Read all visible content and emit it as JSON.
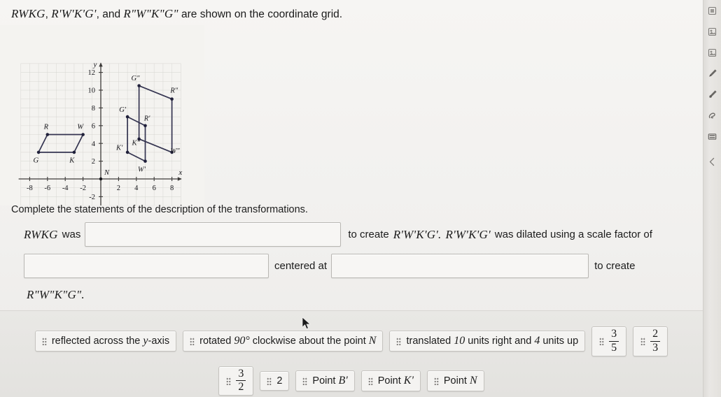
{
  "prompt": {
    "fig1": "RWKG",
    "fig2": "R'W'K'G'",
    "fig3": "R\"W\"K\"G\"",
    "comma": ", ",
    "and": ", and ",
    "tail": " are shown on the coordinate grid."
  },
  "instruction": "Complete the statements of the description of the transformations.",
  "statement": {
    "subject": "RWKG",
    "was": "was",
    "to_create": "to create",
    "created_fig": "R'W'K'G'.",
    "dilated_subject": "R'W'K'G'",
    "dilated_text": "was dilated using a scale factor of",
    "centered_at": "centered at",
    "to_create2": "to create",
    "final_fig": "R\"W\"K\"G\"."
  },
  "answer_bank": {
    "row1": [
      {
        "label": "reflected across the ",
        "math": "y",
        "label2": "-axis",
        "kind": "text"
      },
      {
        "label": "rotated ",
        "math": "90°",
        "label2": " clockwise about the point ",
        "math2": "N",
        "kind": "text"
      },
      {
        "label": "translated ",
        "math": "10",
        "label2": " units right and ",
        "math2": "4",
        "label3": " units up",
        "kind": "text"
      },
      {
        "numerator": "3",
        "denominator": "5",
        "kind": "fraction"
      },
      {
        "numerator": "2",
        "denominator": "3",
        "kind": "fraction"
      }
    ],
    "row2": [
      {
        "numerator": "3",
        "denominator": "2",
        "kind": "fraction"
      },
      {
        "label": "2",
        "kind": "math"
      },
      {
        "label": "Point ",
        "math": "B'",
        "kind": "text"
      },
      {
        "label": "Point ",
        "math": "K'",
        "kind": "text"
      },
      {
        "label": "Point ",
        "math": "N",
        "kind": "text"
      }
    ]
  },
  "toolbar": {
    "items": [
      {
        "name": "note-icon"
      },
      {
        "name": "image-stamp-icon"
      },
      {
        "name": "image-stamp-2-icon"
      },
      {
        "name": "pencil-icon"
      },
      {
        "name": "marker-icon"
      },
      {
        "name": "eraser-icon"
      },
      {
        "name": "highlighter-bar-icon"
      },
      {
        "name": "collapse-chevron-icon"
      }
    ]
  },
  "chart_data": {
    "type": "scatter",
    "title": "",
    "xlabel": "x",
    "ylabel": "y",
    "xlim": [
      -9.4,
      9.2
    ],
    "ylim": [
      -3.2,
      13.2
    ],
    "grid": true,
    "x_ticks": [
      -8,
      -6,
      -4,
      -2,
      2,
      4,
      6,
      8
    ],
    "y_ticks": [
      -2,
      2,
      4,
      6,
      8,
      10,
      12
    ],
    "axis_labels": {
      "x": "x",
      "y": "y"
    },
    "origin_label": "N",
    "series": [
      {
        "name": "RWKG",
        "closed": true,
        "points": [
          {
            "label": "R",
            "x": -6,
            "y": 5,
            "lx": -6.15,
            "ly": 5.9
          },
          {
            "label": "W",
            "x": -2,
            "y": 5,
            "lx": -2.3,
            "ly": 5.9
          },
          {
            "label": "K",
            "x": -3,
            "y": 3,
            "lx": -3.25,
            "ly": 2.15
          },
          {
            "label": "G",
            "x": -7,
            "y": 3,
            "lx": -7.3,
            "ly": 2.15
          }
        ]
      },
      {
        "name": "R'W'K'G'",
        "closed": true,
        "points": [
          {
            "label": "R'",
            "x": 5,
            "y": 6,
            "lx": 5.2,
            "ly": 6.85
          },
          {
            "label": "W'",
            "x": 5,
            "y": 2,
            "lx": 4.6,
            "ly": 1.1
          },
          {
            "label": "K'",
            "x": 3,
            "y": 3,
            "lx": 2.1,
            "ly": 3.55
          },
          {
            "label": "G'",
            "x": 3,
            "y": 7,
            "lx": 2.45,
            "ly": 7.85
          }
        ]
      },
      {
        "name": "R\"W\"K\"G\"",
        "closed": true,
        "points": [
          {
            "label": "R\"",
            "x": 8,
            "y": 9,
            "lx": 8.25,
            "ly": 10.0
          },
          {
            "label": "W\"",
            "x": 8,
            "y": 3,
            "lx": 8.35,
            "ly": 3.2
          },
          {
            "label": "K\"",
            "x": 4.3,
            "y": 4.5,
            "lx": 3.95,
            "ly": 4.1
          },
          {
            "label": "G\"",
            "x": 4.3,
            "y": 10.5,
            "lx": 3.9,
            "ly": 11.4
          }
        ]
      }
    ],
    "line_color": "#343450",
    "point_color": "#20203a",
    "grid_color": "#cfcec9"
  }
}
